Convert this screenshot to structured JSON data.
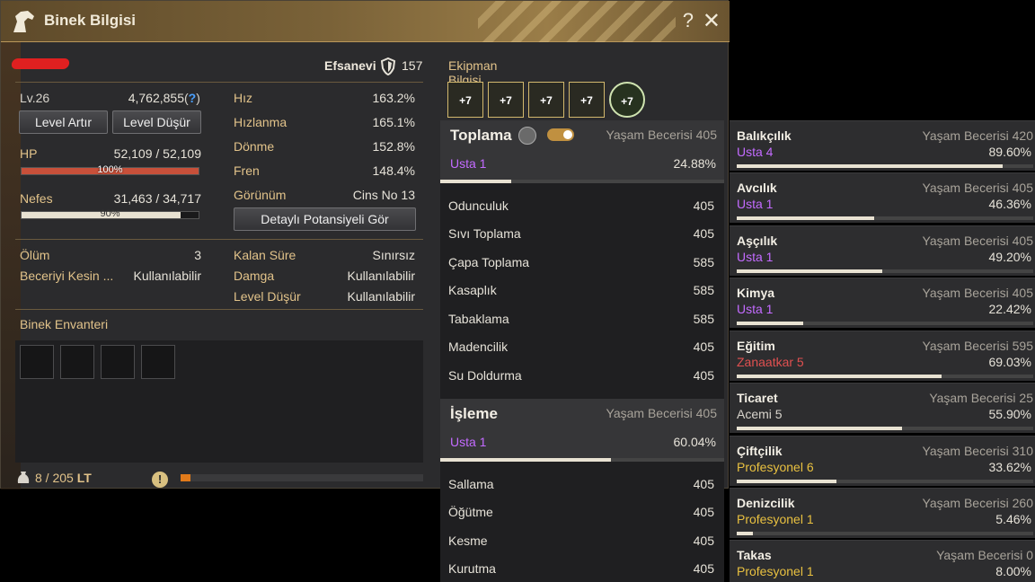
{
  "window": {
    "title": "Binek Bilgisi",
    "help": "?",
    "close": "✕"
  },
  "mount": {
    "grade_label": "Efsanevi",
    "grade_value": "157",
    "level": "Lv.26",
    "exp": "4,762,855",
    "exp_help": "?",
    "level_up_btn": "Level Artır",
    "level_down_btn": "Level Düşür",
    "hp_label": "HP",
    "hp_current": "52,109",
    "hp_max": "52,109",
    "hp_pct_text": "100%",
    "hp_pct": 100,
    "nefes_label": "Nefes",
    "nefes_current": "31,463",
    "nefes_max": "34,717",
    "nefes_pct_text": "90%",
    "nefes_pct": 90,
    "stats": [
      {
        "label": "Hız",
        "value": "163.2%"
      },
      {
        "label": "Hızlanma",
        "value": "165.1%"
      },
      {
        "label": "Dönme",
        "value": "152.8%"
      },
      {
        "label": "Fren",
        "value": "148.4%"
      }
    ],
    "appearance_label": "Görünüm",
    "appearance_value": "Cins No 13",
    "potential_btn": "Detaylı Potansiyeli Gör",
    "death_label": "Ölüm",
    "death_value": "3",
    "skill_label": "Beceriyi Kesin ...",
    "skill_value": "Kullanılabilir",
    "remaining_label": "Kalan Süre",
    "remaining_value": "Sınırsız",
    "stamp_label": "Damga",
    "stamp_value": "Kullanılabilir",
    "lvdown_label": "Level Düşür",
    "lvdown_value": "Kullanılabilir",
    "inventory_title": "Binek Envanteri",
    "weight_current": "8",
    "weight_max": "205",
    "weight_unit": "LT",
    "weight_pct": 4
  },
  "equipment": {
    "title": "Ekipman Bilgisi",
    "items": [
      "+7",
      "+7",
      "+7",
      "+7",
      "+7"
    ]
  },
  "toplama": {
    "title": "Toplama",
    "yasam": "Yaşam Becerisi 405",
    "rank": "Usta 1",
    "pct": "24.88%",
    "pct_val": 24.88,
    "rows": [
      {
        "name": "Odunculuk",
        "value": "405"
      },
      {
        "name": "Sıvı Toplama",
        "value": "405"
      },
      {
        "name": "Çapa Toplama",
        "value": "585"
      },
      {
        "name": "Kasaplık",
        "value": "585"
      },
      {
        "name": "Tabaklama",
        "value": "585"
      },
      {
        "name": "Madencilik",
        "value": "405"
      },
      {
        "name": "Su Doldurma",
        "value": "405"
      }
    ]
  },
  "isleme": {
    "title": "İşleme",
    "yasam": "Yaşam Becerisi 405",
    "rank": "Usta 1",
    "pct": "60.04%",
    "pct_val": 60.04,
    "rows": [
      {
        "name": "Sallama",
        "value": "405"
      },
      {
        "name": "Öğütme",
        "value": "405"
      },
      {
        "name": "Kesme",
        "value": "405"
      },
      {
        "name": "Kurutma",
        "value": "405"
      }
    ]
  },
  "skills": [
    {
      "name": "Balıkçılık",
      "yasam": "Yaşam Becerisi 420",
      "rank": "Usta 4",
      "rank_color": "#c36bff",
      "pct": "89.60%",
      "pct_val": 89.6
    },
    {
      "name": "Avcılık",
      "yasam": "Yaşam Becerisi 405",
      "rank": "Usta 1",
      "rank_color": "#c36bff",
      "pct": "46.36%",
      "pct_val": 46.36
    },
    {
      "name": "Aşçılık",
      "yasam": "Yaşam Becerisi 405",
      "rank": "Usta 1",
      "rank_color": "#c36bff",
      "pct": "49.20%",
      "pct_val": 49.2
    },
    {
      "name": "Kimya",
      "yasam": "Yaşam Becerisi 405",
      "rank": "Usta 1",
      "rank_color": "#c36bff",
      "pct": "22.42%",
      "pct_val": 22.42
    },
    {
      "name": "Eğitim",
      "yasam": "Yaşam Becerisi 595",
      "rank": "Zanaatkar 5",
      "rank_color": "#e05050",
      "pct": "69.03%",
      "pct_val": 69.03
    },
    {
      "name": "Ticaret",
      "yasam": "Yaşam Becerisi 25",
      "rank": "Acemi 5",
      "rank_color": "#d8d4cc",
      "pct": "55.90%",
      "pct_val": 55.9
    },
    {
      "name": "Çiftçilik",
      "yasam": "Yaşam Becerisi 310",
      "rank": "Profesyonel 6",
      "rank_color": "#e8c040",
      "pct": "33.62%",
      "pct_val": 33.62
    },
    {
      "name": "Denizcilik",
      "yasam": "Yaşam Becerisi 260",
      "rank": "Profesyonel 1",
      "rank_color": "#e8c040",
      "pct": "5.46%",
      "pct_val": 5.46
    },
    {
      "name": "Takas",
      "yasam": "Yaşam Becerisi 0",
      "rank": "Profesyonel 1",
      "rank_color": "#e8c040",
      "pct": "8.00%",
      "pct_val": 8.0
    }
  ]
}
